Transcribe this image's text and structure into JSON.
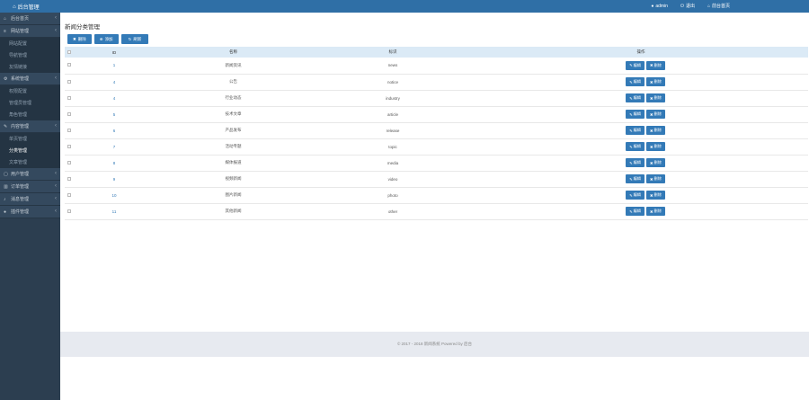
{
  "topbar": {
    "brand": "后台管理",
    "nav": [
      {
        "icon": "user-icon",
        "label": "admin"
      },
      {
        "icon": "power-icon",
        "label": "退出"
      },
      {
        "icon": "home-icon",
        "label": "前台首页"
      }
    ]
  },
  "sidebar": {
    "groups": [
      {
        "icon": "home-icon",
        "label": "后台首页",
        "items": []
      },
      {
        "icon": "list-icon",
        "label": "网站管理",
        "items": [
          "网站配置",
          "导航管理",
          "友情链接"
        ]
      },
      {
        "icon": "gear-icon",
        "label": "系统管理",
        "items": [
          "权限配置",
          "管理员管理",
          "角色管理"
        ]
      },
      {
        "icon": "doc-icon",
        "label": "内容管理",
        "items": [
          "单页管理",
          "分类管理",
          "文章管理"
        ]
      },
      {
        "icon": "file-icon",
        "label": "用户管理",
        "items": []
      },
      {
        "icon": "chart-icon",
        "label": "订单管理",
        "items": []
      },
      {
        "icon": "bell-icon",
        "label": "消息管理",
        "items": []
      },
      {
        "icon": "user-icon",
        "label": "插件管理",
        "items": []
      }
    ],
    "active_item": "分类管理"
  },
  "page": {
    "title": "新闻分类管理",
    "toolbar": {
      "delete": "删除",
      "add": "添加",
      "refresh": "刷新"
    }
  },
  "table": {
    "headers": [
      "ID",
      "名称",
      "标识",
      "操作"
    ],
    "edit_label": "编辑",
    "delete_label": "删除",
    "rows": [
      {
        "id": "1",
        "name": "新闻资讯",
        "key": "news"
      },
      {
        "id": "4",
        "name": "公告",
        "key": "notice"
      },
      {
        "id": "4",
        "name": "行业动态",
        "key": "industry"
      },
      {
        "id": "5",
        "name": "技术文章",
        "key": "article"
      },
      {
        "id": "6",
        "name": "产品发布",
        "key": "release"
      },
      {
        "id": "7",
        "name": "活动专题",
        "key": "topic"
      },
      {
        "id": "8",
        "name": "媒体报道",
        "key": "media"
      },
      {
        "id": "9",
        "name": "视频新闻",
        "key": "video"
      },
      {
        "id": "10",
        "name": "图片新闻",
        "key": "photo"
      },
      {
        "id": "11",
        "name": "其他新闻",
        "key": "other"
      }
    ]
  },
  "footer": {
    "text": "© 2017 - 2018 新闻系统 Powered by 后台"
  }
}
